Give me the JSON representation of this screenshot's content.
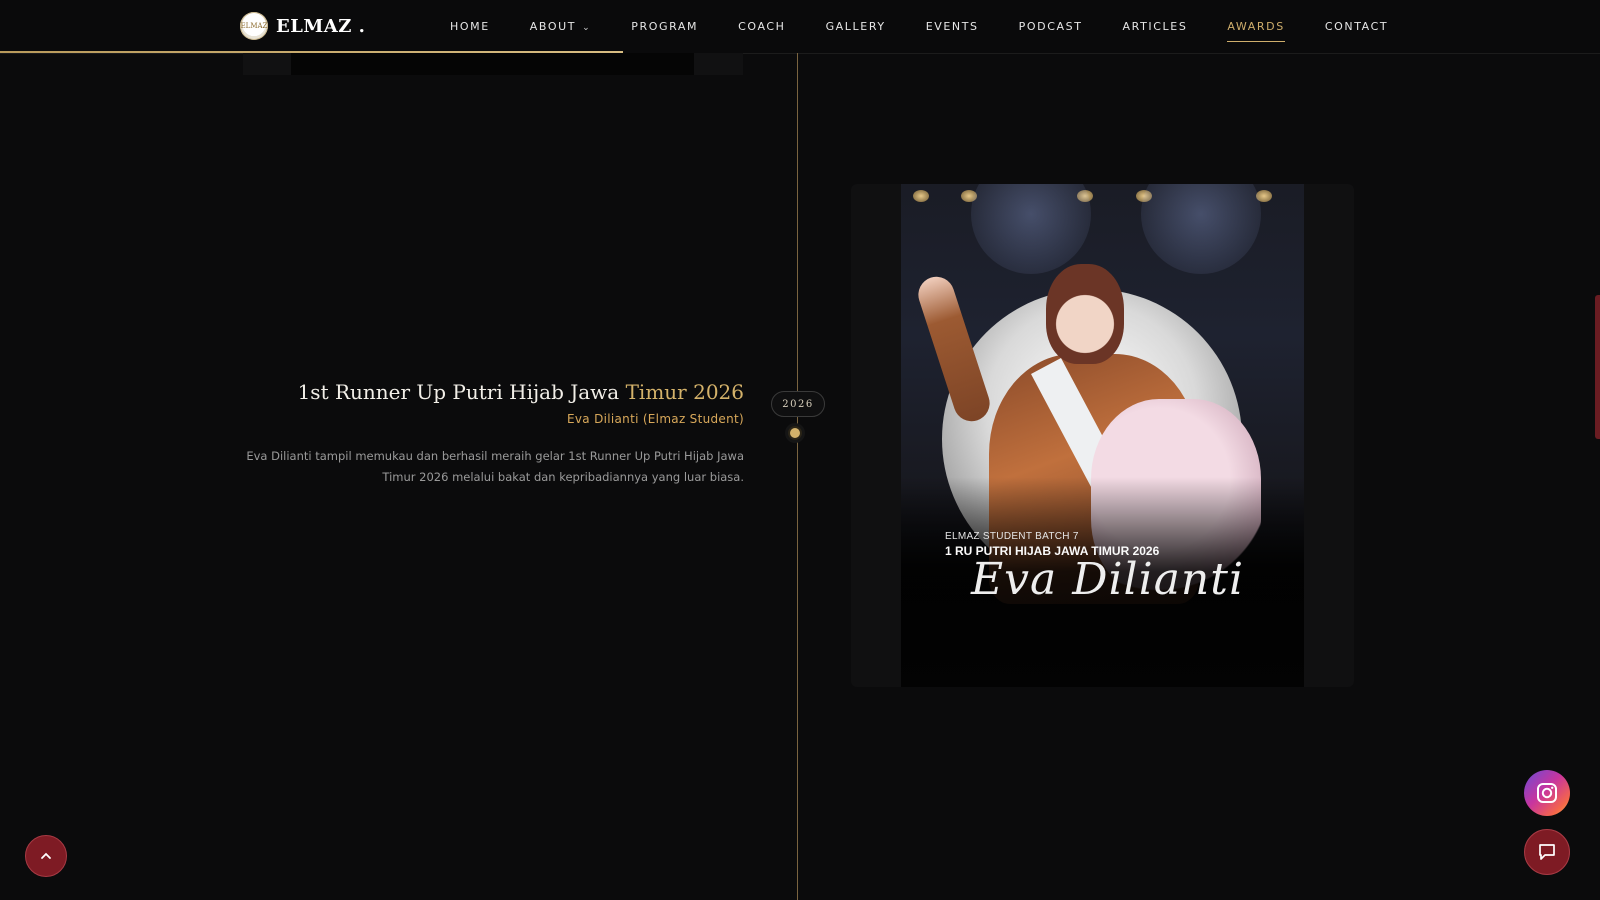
{
  "brand": {
    "logo_text": "ELMAZ",
    "name": "ELMAZ ."
  },
  "nav": {
    "items": [
      {
        "label": "HOME"
      },
      {
        "label": "ABOUT"
      },
      {
        "label": "PROGRAM"
      },
      {
        "label": "COACH"
      },
      {
        "label": "GALLERY"
      },
      {
        "label": "EVENTS"
      },
      {
        "label": "PODCAST"
      },
      {
        "label": "ARTICLES"
      },
      {
        "label": "AWARDS"
      },
      {
        "label": "CONTACT"
      }
    ],
    "active": "AWARDS",
    "accent_color": "#cfae6c"
  },
  "award": {
    "year": "2026",
    "title_main": "1st Runner Up Putri Hijab Jawa ",
    "title_highlight": "Timur 2026",
    "recipient": "Eva Dilianti (Elmaz Student)",
    "description": "Eva Dilianti tampil memukau dan berhasil meraih gelar 1st Runner Up Putri Hijab Jawa Timur 2026 melalui bakat dan kepribadiannya yang luar biasa."
  },
  "poster": {
    "batch": "ELMAZ STUDENT BATCH 7",
    "rank": "1 RU PUTRI HIJAB JAWA TIMUR 2026",
    "name": "Eva Dilianti"
  },
  "icons": {
    "back_to_top": "chevron-up-icon",
    "instagram": "instagram-icon",
    "chat": "chat-icon"
  },
  "colors": {
    "gold": "#d4b26a",
    "maroon": "#7e1b24",
    "background": "#0b0b0c"
  }
}
